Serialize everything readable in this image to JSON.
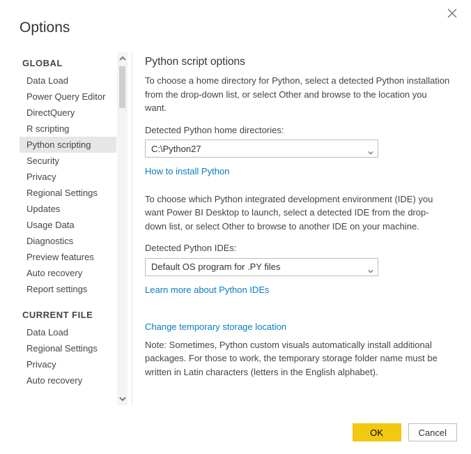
{
  "window": {
    "title": "Options"
  },
  "sidebar": {
    "section_global": "GLOBAL",
    "section_current": "CURRENT FILE",
    "global_items": [
      {
        "label": "Data Load"
      },
      {
        "label": "Power Query Editor"
      },
      {
        "label": "DirectQuery"
      },
      {
        "label": "R scripting"
      },
      {
        "label": "Python scripting"
      },
      {
        "label": "Security"
      },
      {
        "label": "Privacy"
      },
      {
        "label": "Regional Settings"
      },
      {
        "label": "Updates"
      },
      {
        "label": "Usage Data"
      },
      {
        "label": "Diagnostics"
      },
      {
        "label": "Preview features"
      },
      {
        "label": "Auto recovery"
      },
      {
        "label": "Report settings"
      }
    ],
    "current_items": [
      {
        "label": "Data Load"
      },
      {
        "label": "Regional Settings"
      },
      {
        "label": "Privacy"
      },
      {
        "label": "Auto recovery"
      }
    ]
  },
  "content": {
    "heading": "Python script options",
    "intro": "To choose a home directory for Python, select a detected Python installation from the drop-down list, or select Other and browse to the location you want.",
    "home_label": "Detected Python home directories:",
    "home_value": "C:\\Python27",
    "install_link": "How to install Python",
    "ide_intro": "To choose which Python integrated development environment (IDE) you want Power BI Desktop to launch, select a detected IDE from the drop-down list, or select Other to browse to another IDE on your machine.",
    "ide_label": "Detected Python IDEs:",
    "ide_value": "Default OS program for .PY files",
    "ide_link": "Learn more about Python IDEs",
    "storage_link": "Change temporary storage location",
    "storage_note": "Note: Sometimes, Python custom visuals automatically install additional packages. For those to work, the temporary storage folder name must be written in Latin characters (letters in the English alphabet)."
  },
  "footer": {
    "ok": "OK",
    "cancel": "Cancel"
  }
}
